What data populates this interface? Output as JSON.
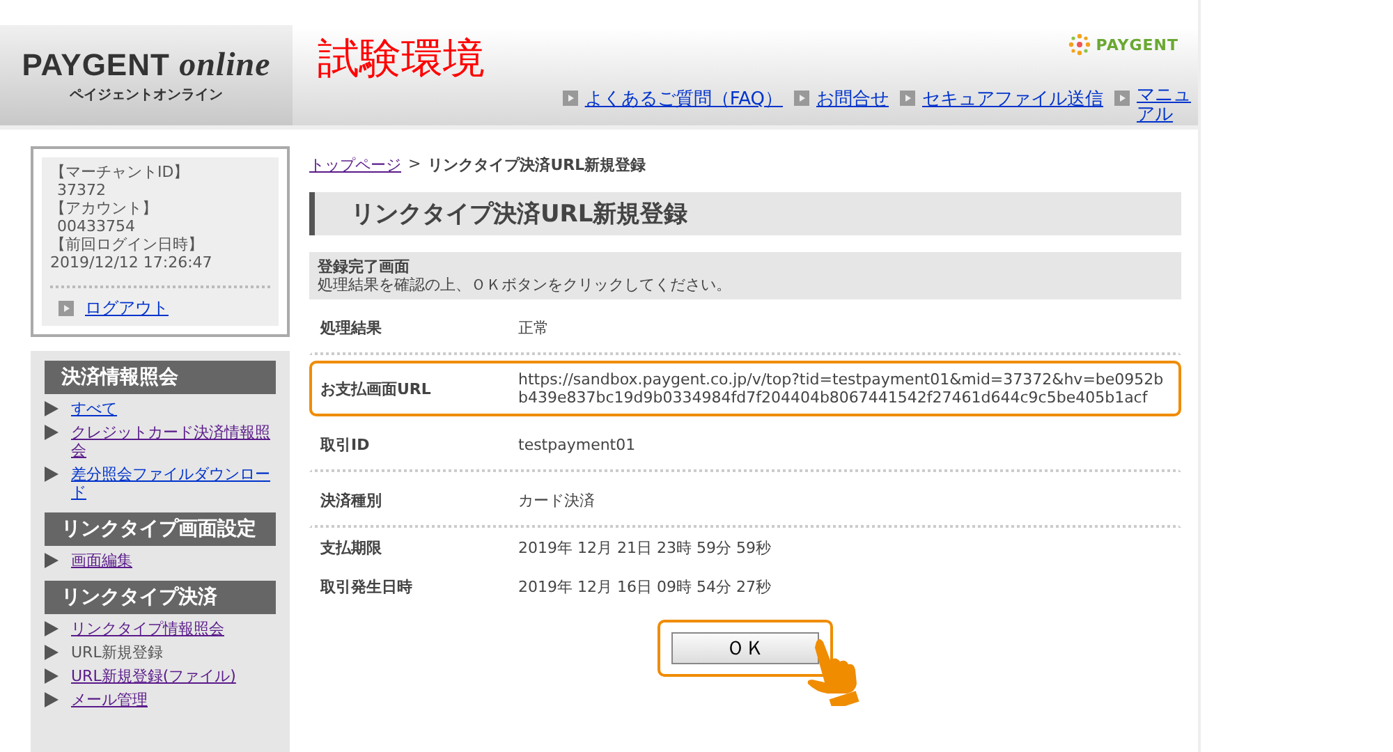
{
  "header": {
    "logo": {
      "main": "PAYGENT",
      "script": "online",
      "sub": "ペイジェントオンライン"
    },
    "environment": "試験環境",
    "brand": "PAYGENT",
    "links": [
      {
        "label": "よくあるご質問（FAQ）"
      },
      {
        "label": "お問合せ"
      },
      {
        "label": "セキュアファイル送信"
      },
      {
        "label": "マニュアル"
      }
    ]
  },
  "account": {
    "lines": [
      "【マーチャントID】",
      "37372",
      "【アカウント】",
      "00433754",
      "【前回ログイン日時】",
      "2019/12/12 17:26:47"
    ],
    "logout": "ログアウト"
  },
  "menu": [
    {
      "heading": "決済情報照会",
      "items": [
        {
          "label": "すべて",
          "selected": false,
          "visited": false
        },
        {
          "label": "クレジットカード決済情報照会",
          "selected": false,
          "visited": true
        },
        {
          "label": "差分照会ファイルダウンロード",
          "selected": false,
          "visited": false
        }
      ]
    },
    {
      "heading": "リンクタイプ画面設定",
      "items": [
        {
          "label": "画面編集",
          "selected": false,
          "visited": true
        }
      ]
    },
    {
      "heading": "リンクタイプ決済",
      "items": [
        {
          "label": "リンクタイプ情報照会",
          "selected": false,
          "visited": true
        },
        {
          "label": "URL新規登録",
          "selected": true
        },
        {
          "label": "URL新規登録(ファイル)",
          "selected": false,
          "visited": true
        },
        {
          "label": "メール管理",
          "selected": false,
          "visited": true
        }
      ]
    }
  ],
  "breadcrumb": {
    "link": "トップページ",
    "separator": ">",
    "current": "リンクタイプ決済URL新規登録"
  },
  "page_title": "リンクタイプ決済URL新規登録",
  "notice": {
    "title": "登録完了画面",
    "text": "処理結果を確認の上、ＯＫボタンをクリックしてください。"
  },
  "rows": [
    {
      "label": "処理結果",
      "value": "正常",
      "highlighted": false,
      "divider": true
    },
    {
      "label": "お支払画面URL",
      "value": "https://sandbox.paygent.co.jp/v/top?tid=testpayment01&mid=37372&hv=be0952bb439e837bc19d9b0334984fd7f204404b8067441542f27461d644c9c5be405b1acf",
      "highlighted": true,
      "divider": true
    },
    {
      "label": "取引ID",
      "value": "testpayment01",
      "highlighted": false,
      "divider": true
    },
    {
      "label": "決済種別",
      "value": "カード決済",
      "highlighted": false,
      "divider": true
    },
    {
      "label": "支払期限",
      "value": "2019年 12月 21日 23時 59分 59秒",
      "highlighted": false,
      "divider": false
    },
    {
      "label": "取引発生日時",
      "value": "2019年 12月 16日 09時 54分 27秒",
      "highlighted": false,
      "divider": false
    }
  ],
  "ok_button": {
    "label": "ＯＫ",
    "highlighted": true
  }
}
